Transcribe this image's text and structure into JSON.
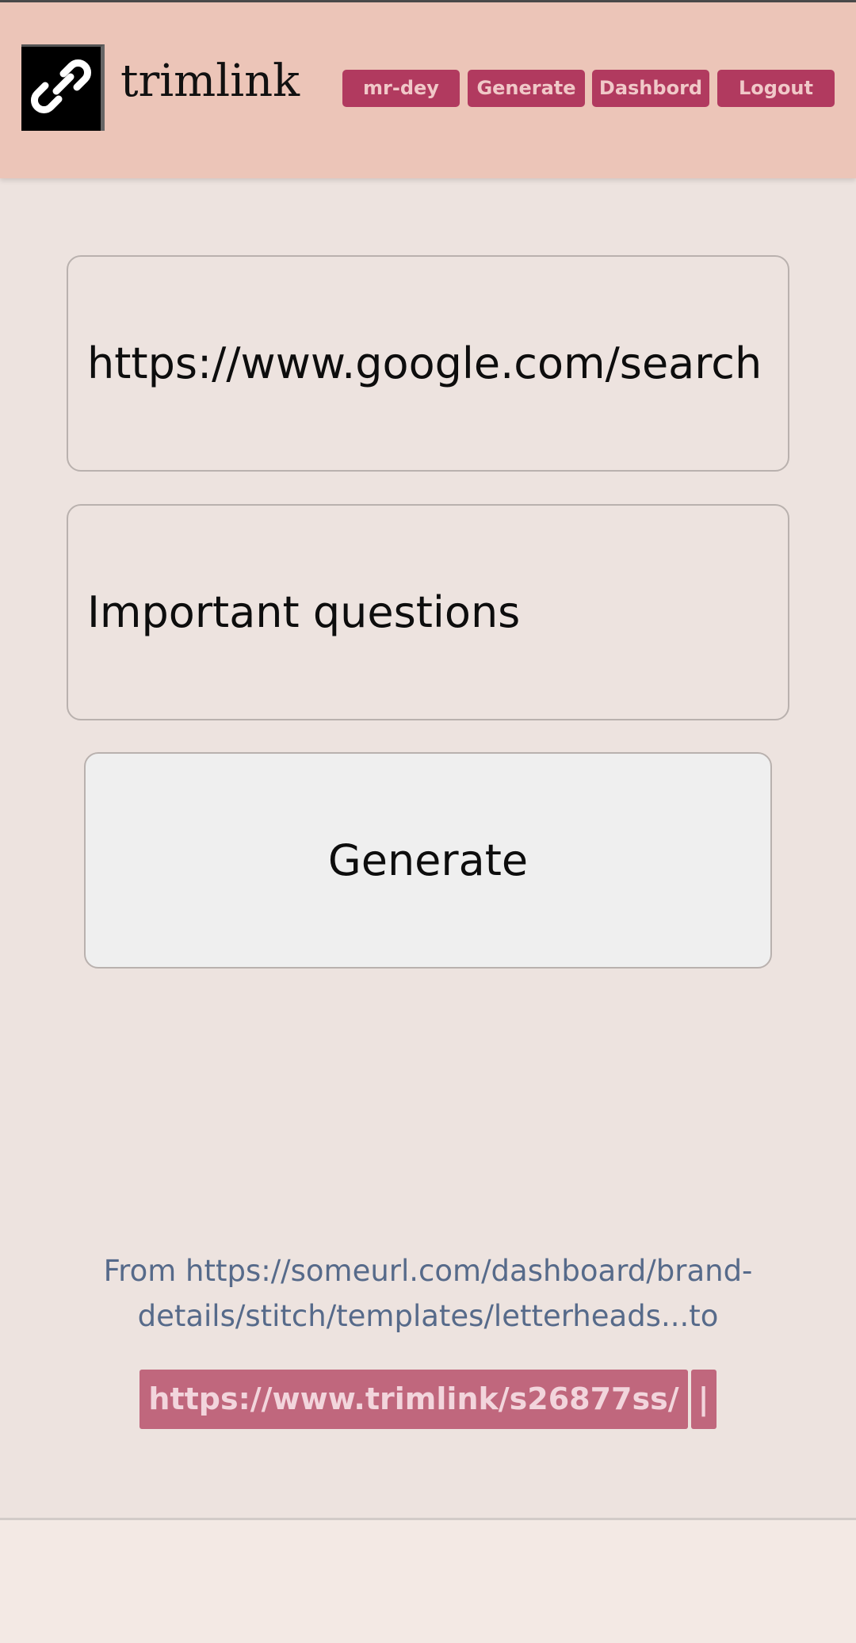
{
  "header": {
    "brand": "trimlink",
    "nav": [
      "mr-dey",
      "Generate",
      "Dashbord",
      "Logout"
    ]
  },
  "form": {
    "url_value": "https://www.google.com/search",
    "title_value": "Important questions",
    "generate_label": "Generate"
  },
  "result": {
    "from_text": "From https://someurl.com/dashboard/brand-details/stitch/templates/letterheads...to",
    "short_url": "https://www.trimlink/s26877ss/",
    "copy_label": "|"
  },
  "icons": {
    "logo": "link-icon"
  },
  "colors": {
    "header_bg": "#ecc5b8",
    "nav_button": "#b13a5f",
    "short_link_bg": "#c0677d",
    "page_bg": "#ede3df"
  }
}
